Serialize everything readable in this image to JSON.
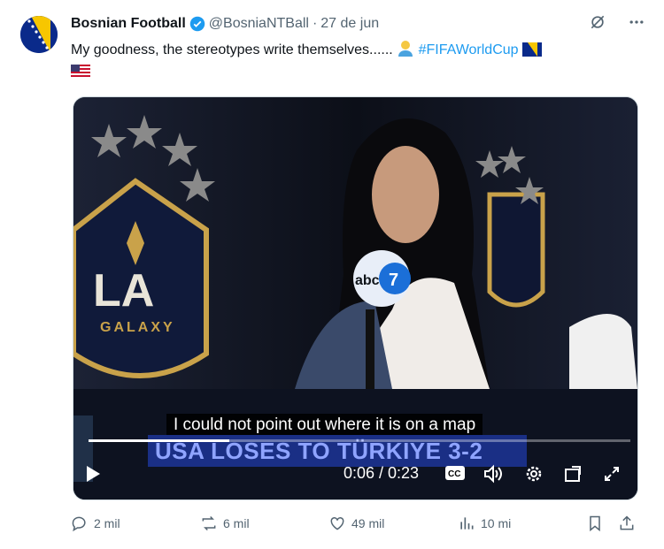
{
  "author": {
    "name": "Bosnian Football",
    "handle": "@BosniaNTBall",
    "separator": "·",
    "date": "27 de jun"
  },
  "tweet": {
    "text_main": "My goodness, the stereotypes write themselves......",
    "hashtag": "#FIFAWorldCup"
  },
  "video": {
    "subtitle": "I could not point out where it is on a map",
    "banner": "USA LOSES TO TÜRKIYE 3-2",
    "logo_text": "LA",
    "club_text": "GALAXY",
    "channel_logo": "abc",
    "channel_number": "7",
    "time": "0:06 / 0:23",
    "progress": 0.26
  },
  "actions": {
    "replies": "2 mil",
    "reposts": "6 mil",
    "likes": "49 mil",
    "views": "10 mi"
  },
  "colors": {
    "accent": "#1d9bf0",
    "banner_bg": "#1a2f85",
    "muted": "#536471"
  }
}
